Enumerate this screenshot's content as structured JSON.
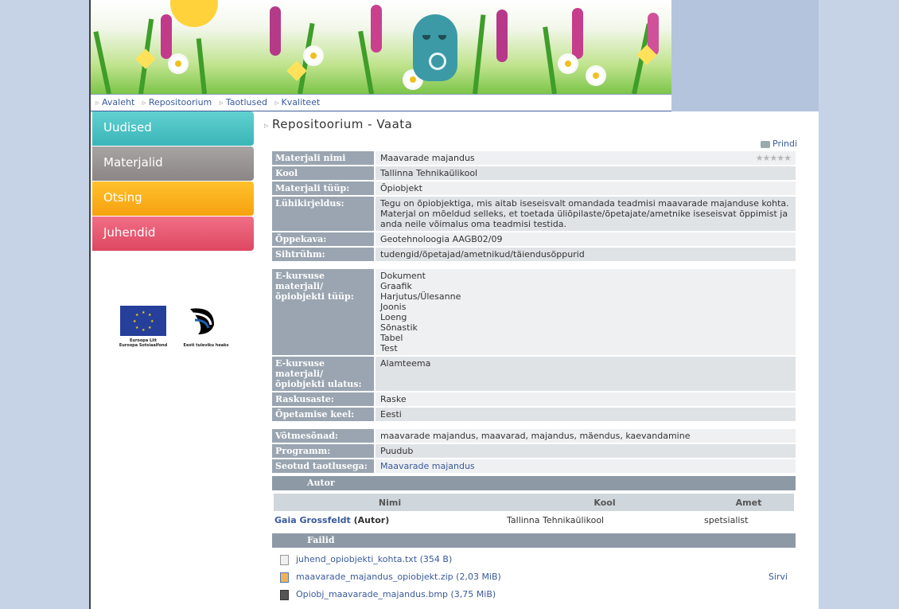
{
  "breadcrumb": [
    "Avaleht",
    "Repositoorium",
    "Taotlused",
    "Kvaliteet"
  ],
  "sidebar": {
    "items": [
      {
        "label": "Uudised",
        "color": "#3ab5b8"
      },
      {
        "label": "Materjalid",
        "color": "#8b8585"
      },
      {
        "label": "Otsing",
        "color": "#f6a110"
      },
      {
        "label": "Juhendid",
        "color": "#de4761"
      }
    ],
    "logos": {
      "eu_line1": "Euroopa Liit",
      "eu_line2": "Euroopa Sotsiaalfond",
      "estonia": "Eesti tuleviku heaks"
    }
  },
  "main": {
    "title": "Repositoorium - Vaata",
    "print": "Prindi",
    "rating": "★★★★★",
    "fields": {
      "material_name": {
        "label": "Materjali nimi",
        "value": "Maavarade majandus"
      },
      "school": {
        "label": "Kool",
        "value": "Tallinna Tehnikaülikool"
      },
      "type": {
        "label": "Materjali tüüp:",
        "value": "Õpiobjekt"
      },
      "summary": {
        "label": "Lühikirjeldus:",
        "value": "Tegu on õpiobjektiga, mis aitab iseseisvalt omandada teadmisi maavarade majanduse kohta. Materjal on mõeldud selleks, et toetada üliõpilaste/õpetajate/ametnike iseseisvat õppimist ja anda neile võimalus oma teadmisi testida."
      },
      "curriculum": {
        "label": "Õppekava:",
        "value": "Geotehnoloogia AAGB02/09"
      },
      "audience": {
        "label": "Sihtrühm:",
        "value": "tudengid/õpetajad/ametnikud/täiendusõppurid"
      },
      "ecourse_type": {
        "label": "E-kursuse materjali/ õpiobjekti tüüp:",
        "values": [
          "Dokument",
          "Graafik",
          "Harjutus/Ülesanne",
          "Joonis",
          "Loeng",
          "Sõnastik",
          "Tabel",
          "Test"
        ]
      },
      "ecourse_scope": {
        "label": "E-kursuse materjali/ õpiobjekti ulatus:",
        "value": "Alamteema"
      },
      "difficulty": {
        "label": "Raskusaste:",
        "value": "Raske"
      },
      "language": {
        "label": "Õpetamise keel:",
        "value": "Eesti"
      },
      "keywords": {
        "label": "Võtmesõnad:",
        "value": "maavarade majandus, maavarad, majandus, mäendus, kaevandamine"
      },
      "program": {
        "label": "Programm:",
        "value": "Puudub"
      },
      "related": {
        "label": "Seotud taotlusega:",
        "value": "Maavarade majandus"
      }
    },
    "author_section": {
      "title": "Autor",
      "headers": [
        "Nimi",
        "Kool",
        "Amet"
      ],
      "rows": [
        {
          "name": "Gaia Grossfeldt",
          "role_tag": "(Autor)",
          "school": "Tallinna Tehnikaülikool",
          "position": "spetsialist"
        }
      ]
    },
    "files_section": {
      "title": "Failid",
      "files": [
        {
          "name": "juhend_opiobjekti_kohta.txt (354 B)",
          "icon": "text-file-icon",
          "action": ""
        },
        {
          "name": "maavarade_majandus_opiobjekt.zip (2,03 MiB)",
          "icon": "zip-file-icon",
          "action": "Sirvi"
        },
        {
          "name": "Opiobj_maavarade_majandus.bmp (3,75 MiB)",
          "icon": "image-file-icon",
          "action": ""
        }
      ]
    }
  }
}
